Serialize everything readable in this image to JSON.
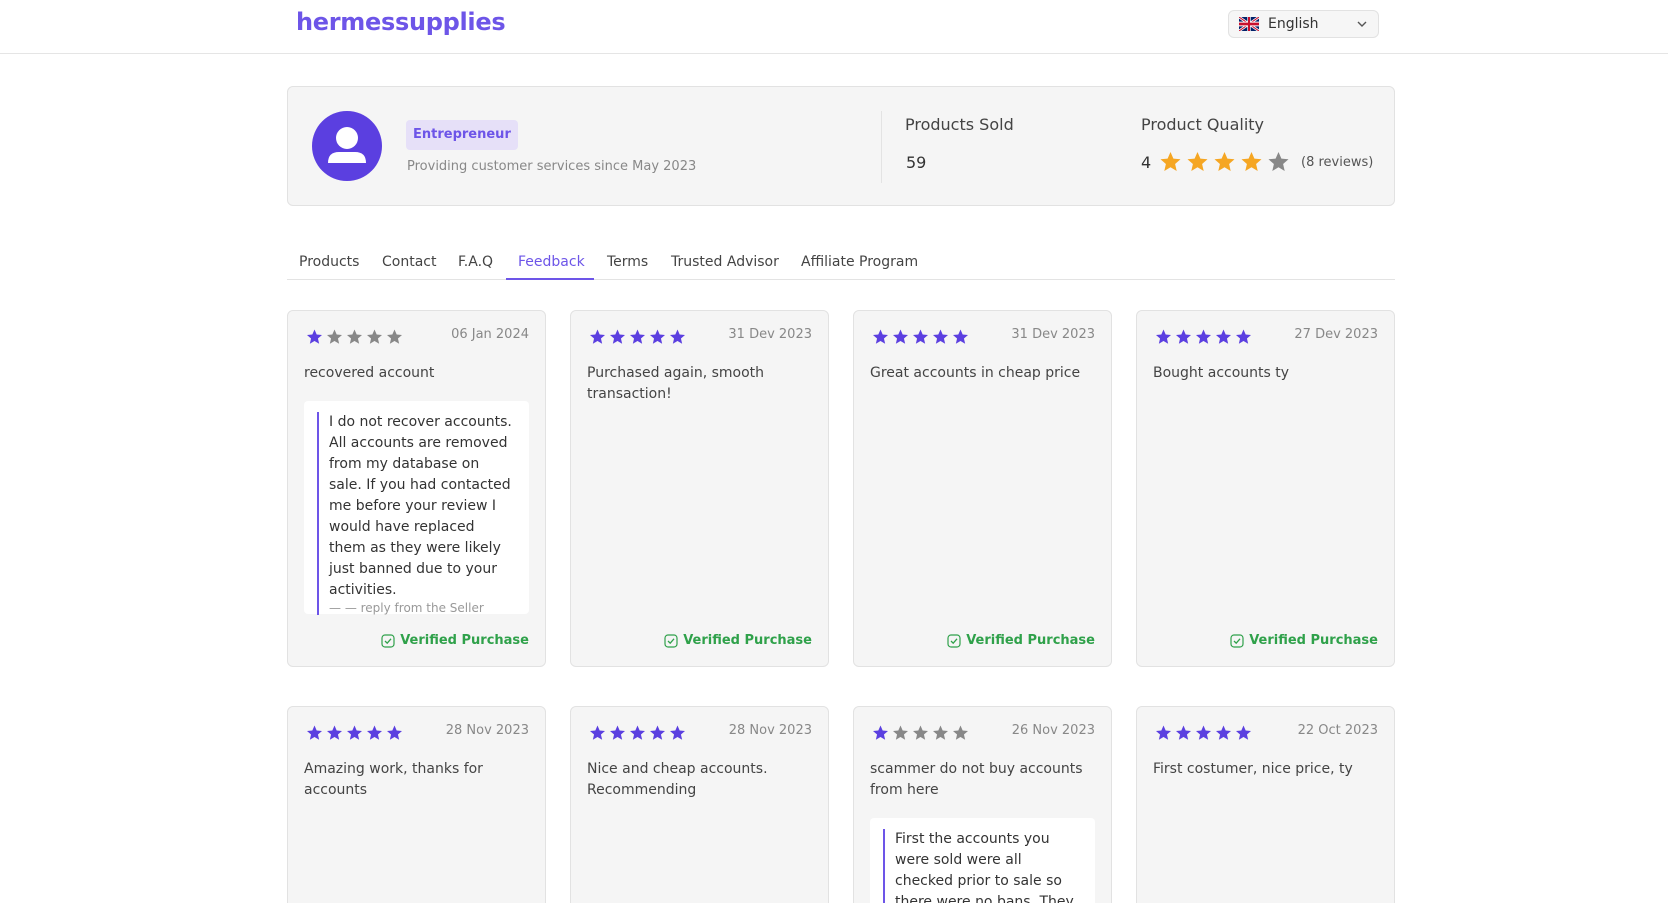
{
  "header": {
    "brand": "hermessupplies",
    "language": "English",
    "language_flag": "uk-flag-icon"
  },
  "profile": {
    "badge": "Entrepreneur",
    "since": "Providing customer services since May 2023",
    "sold_label": "Products Sold",
    "sold_value": "59",
    "quality_label": "Product Quality",
    "quality_value": "4",
    "quality_rating": 4,
    "reviews_count": "(8 reviews)"
  },
  "tabs": [
    {
      "label": "Products"
    },
    {
      "label": "Contact"
    },
    {
      "label": "F.A.Q"
    },
    {
      "label": "Feedback",
      "active": true
    },
    {
      "label": "Terms"
    },
    {
      "label": "Trusted Advisor"
    },
    {
      "label": "Affiliate Program"
    }
  ],
  "reviews": [
    {
      "rating": 1,
      "date": "06 Jan 2024",
      "text": "recovered account",
      "reply": "I do not recover accounts. All accounts are removed from my database on sale. If you had contacted me before your review I would have replaced them as they were likely just banned due to your activities.",
      "reply_from": "— — reply from the Seller",
      "verified": "Verified Purchase"
    },
    {
      "rating": 5,
      "date": "31 Dev 2023",
      "text": "Purchased again, smooth transaction!",
      "verified": "Verified Purchase"
    },
    {
      "rating": 5,
      "date": "31 Dev 2023",
      "text": "Great accounts in cheap price",
      "verified": "Verified Purchase"
    },
    {
      "rating": 5,
      "date": "27 Dev 2023",
      "text": "Bought accounts ty",
      "verified": "Verified Purchase"
    },
    {
      "rating": 5,
      "date": "28 Nov 2023",
      "text": "Amazing work, thanks for accounts"
    },
    {
      "rating": 5,
      "date": "28 Nov 2023",
      "text": "Nice and cheap accounts. Recommending"
    },
    {
      "rating": 1,
      "date": "26 Nov 2023",
      "text": "scammer do not buy accounts from here",
      "reply": "First the accounts you were sold were all checked prior to sale so there were no bans. They are all"
    },
    {
      "rating": 5,
      "date": "22 Oct 2023",
      "text": "First costumer, nice price, ty"
    }
  ],
  "colors": {
    "accent": "#6d55e8",
    "verified": "#2fa14a",
    "star_gold": "#f5a623",
    "star_purple": "#5b3fe0",
    "star_gray": "#888888"
  }
}
